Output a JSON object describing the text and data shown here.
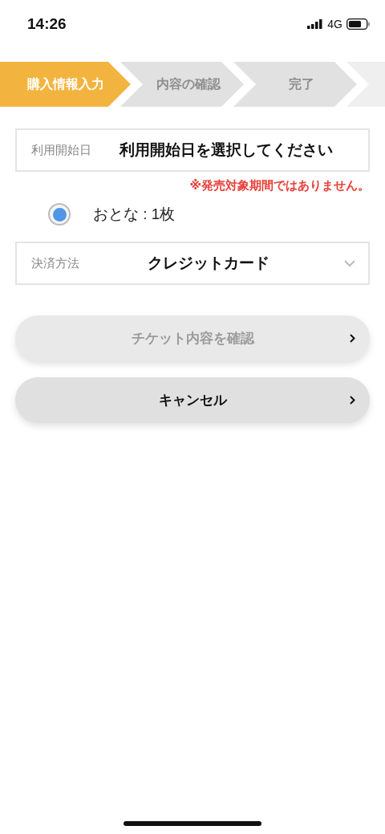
{
  "status_bar": {
    "time": "14:26",
    "network": "4G"
  },
  "steps": [
    {
      "label": "購入情報入力",
      "selected": true
    },
    {
      "label": "内容の確認",
      "selected": false
    },
    {
      "label": "完了",
      "selected": false
    }
  ],
  "date_field": {
    "label": "利用開始日",
    "placeholder": "利用開始日を選択してください"
  },
  "error": "※発売対象期間ではありません。",
  "ticket_option": {
    "label": "おとな : 1枚",
    "selected": true
  },
  "payment_field": {
    "label": "決済方法",
    "value": "クレジットカード"
  },
  "buttons": [
    {
      "label": "チケット内容を確認",
      "disabled": true
    },
    {
      "label": "キャンセル",
      "disabled": false
    }
  ]
}
